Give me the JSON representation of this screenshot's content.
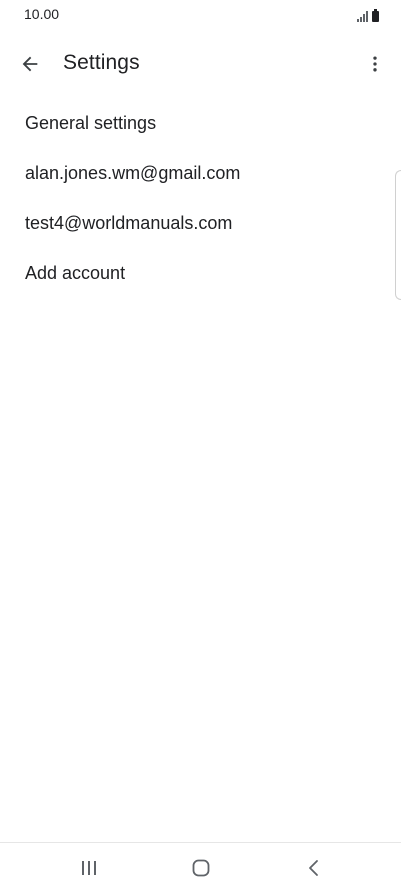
{
  "status_bar": {
    "time": "10.00",
    "icons": [
      "signal-icon",
      "battery-icon"
    ]
  },
  "header": {
    "title": "Settings",
    "back_icon": "arrow-back-icon",
    "menu_icon": "more-vert-icon"
  },
  "settings": {
    "items": [
      {
        "label": "General settings"
      },
      {
        "label": "alan.jones.wm@gmail.com"
      },
      {
        "label": "test4@worldmanuals.com"
      },
      {
        "label": "Add account"
      }
    ]
  },
  "navigation": {
    "icons": [
      "recents-icon",
      "home-icon",
      "back-icon"
    ]
  },
  "colors": {
    "text": "#202124",
    "icon": "#5f6368",
    "background": "#ffffff"
  }
}
